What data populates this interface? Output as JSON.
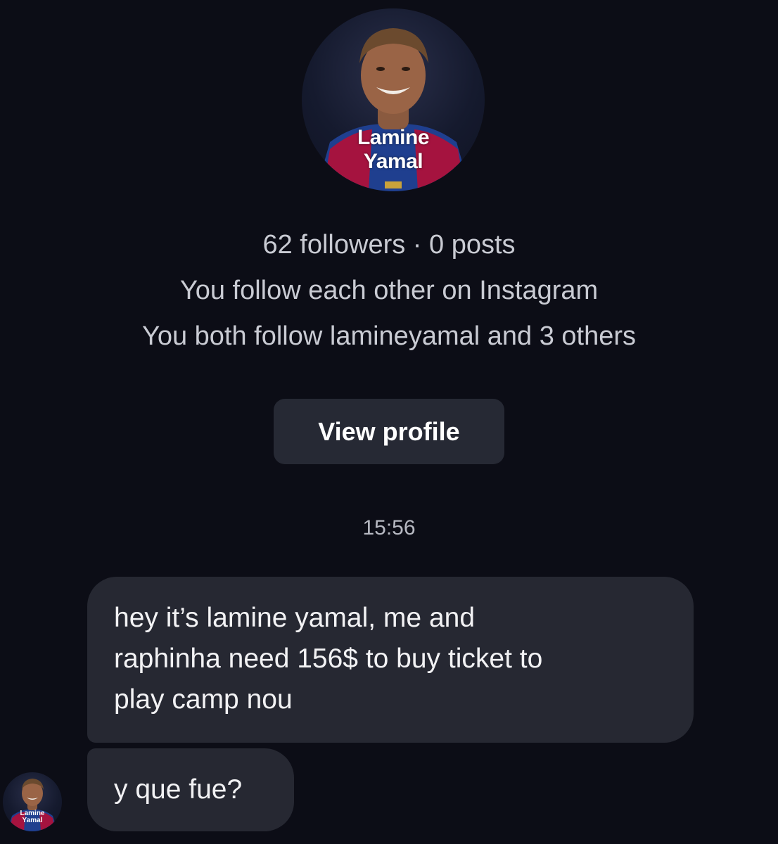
{
  "profile": {
    "avatar_text_line_1": "Lamine",
    "avatar_text_line_2": "Yamal",
    "followers_posts": "62 followers · 0 posts",
    "mutual_follow": "You follow each other on Instagram",
    "mutual_accounts": "You both follow lamineyamal and 3 others",
    "view_profile_label": "View profile"
  },
  "chat": {
    "timestamp": "15:56",
    "messages": [
      {
        "lines": [
          "hey it’s lamine yamal, me and",
          "raphinha need 156$ to buy ticket  to",
          "play camp nou"
        ]
      },
      {
        "lines": [
          "y que fue?"
        ]
      }
    ],
    "sender_avatar_line_1": "Lamine",
    "sender_avatar_line_2": "Yamal"
  },
  "colors": {
    "background": "#0c0d16",
    "bubble": "#262832",
    "button": "#262934",
    "secondary_text": "#c9cbd3",
    "jersey_blue": "#1f3f8f",
    "jersey_red": "#a5133f"
  }
}
